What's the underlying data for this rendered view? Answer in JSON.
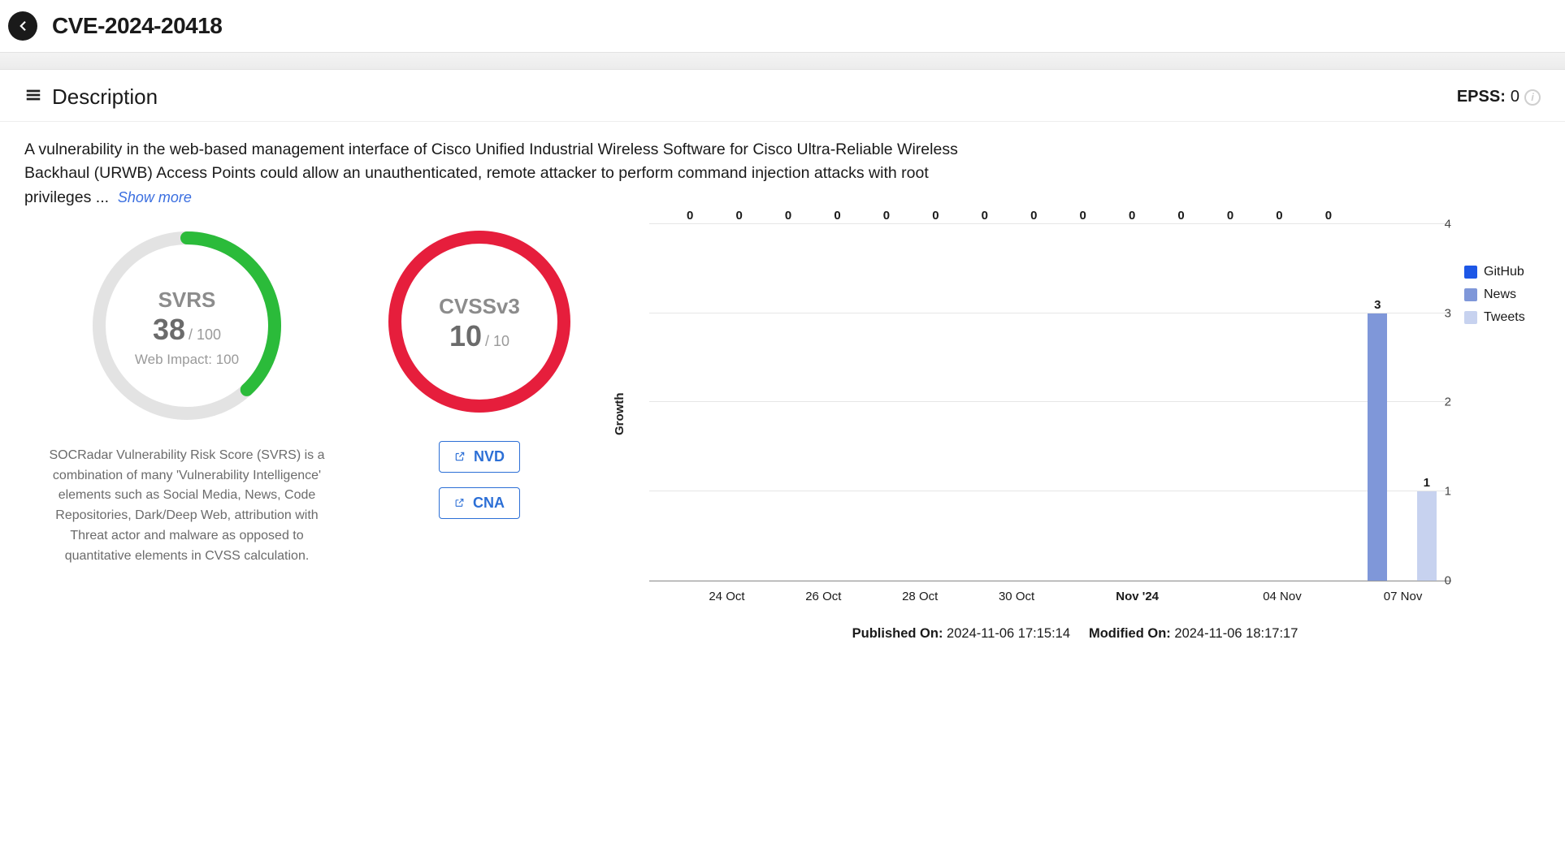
{
  "header": {
    "cve_id": "CVE-2024-20418"
  },
  "section": {
    "title": "Description"
  },
  "epss": {
    "label": "EPSS:",
    "value": "0"
  },
  "description": {
    "text": "A vulnerability in the web-based management interface of Cisco Unified Industrial Wireless Software for Cisco Ultra-Reliable Wireless Backhaul (URWB) Access Points could allow an unauthenticated, remote attacker to perform command injection attacks with root privileges ...",
    "show_more": "Show more"
  },
  "svrs": {
    "label": "SVRS",
    "score": "38",
    "max": "/ 100",
    "web_impact": "Web Impact: 100",
    "note": "SOCRadar Vulnerability Risk Score (SVRS) is a combination of many 'Vulnerability Intelligence' elements such as Social Media, News, Code Repositories, Dark/Deep Web, attribution with Threat actor and malware as opposed to quantitative elements in CVSS calculation.",
    "color": "#2bbb3a"
  },
  "cvss": {
    "label": "CVSSv3",
    "score": "10",
    "max": "/ 10",
    "color": "#e61e3c"
  },
  "links": {
    "nvd": "NVD",
    "cna": "CNA"
  },
  "chart_data": {
    "type": "bar",
    "title": "",
    "ylabel": "Growth",
    "xlabel": "",
    "ylim": [
      0,
      4
    ],
    "y_ticks": [
      0,
      1,
      2,
      3,
      4
    ],
    "categories": [
      "24 Oct",
      "",
      "26 Oct",
      "",
      "28 Oct",
      "",
      "30 Oct",
      "",
      "Nov '24",
      "",
      "",
      "04 Nov",
      "",
      "",
      "07 Nov",
      ""
    ],
    "series": [
      {
        "name": "GitHub",
        "color": "#1d57e6",
        "values": [
          0,
          0,
          0,
          0,
          0,
          0,
          0,
          0,
          0,
          0,
          0,
          0,
          0,
          0,
          0,
          0
        ]
      },
      {
        "name": "News",
        "color": "#7f97d9",
        "values": [
          0,
          0,
          0,
          0,
          0,
          0,
          0,
          0,
          0,
          0,
          0,
          0,
          0,
          0,
          3,
          0
        ]
      },
      {
        "name": "Tweets",
        "color": "#c7d2ef",
        "values": [
          0,
          0,
          0,
          0,
          0,
          0,
          0,
          0,
          0,
          0,
          0,
          0,
          0,
          0,
          0,
          1
        ]
      }
    ],
    "bar_labels": [
      "0",
      "0",
      "0",
      "0",
      "0",
      "0",
      "0",
      "0",
      "0",
      "0",
      "0",
      "0",
      "0",
      "0",
      "3",
      "1"
    ],
    "legend_position": "right"
  },
  "meta": {
    "published_label": "Published On:",
    "published_value": "2024-11-06 17:15:14",
    "modified_label": "Modified On:",
    "modified_value": "2024-11-06 18:17:17"
  }
}
